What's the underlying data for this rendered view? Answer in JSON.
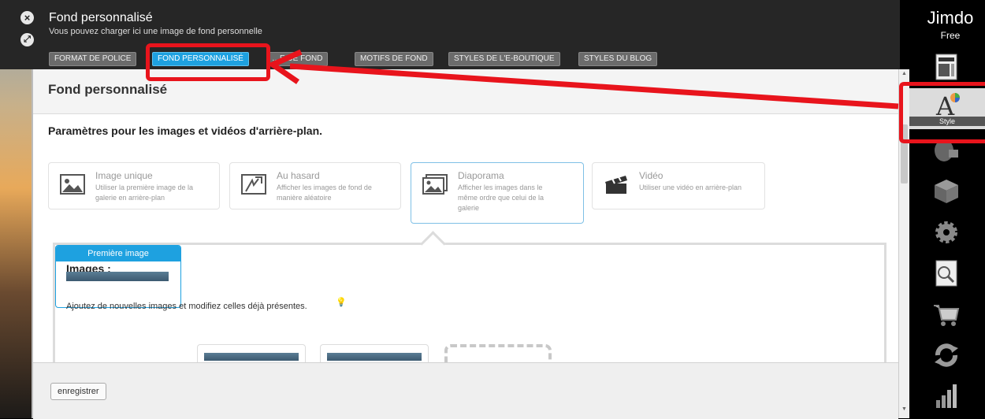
{
  "window": {
    "title": "Fond personnalisé",
    "subtitle": "Vous pouvez charger ici une image de fond personnelle",
    "close_icon": "close-icon",
    "resize_icon": "resize-icon"
  },
  "tabs": [
    {
      "label": "FORMAT DE POLICE",
      "active": false
    },
    {
      "label": "FOND PERSONNALISÉ",
      "active": true
    },
    {
      "label": "…E DE FOND",
      "active": false
    },
    {
      "label": "MOTIFS DE FOND",
      "active": false
    },
    {
      "label": "STYLES DE L'E-BOUTIQUE",
      "active": false
    },
    {
      "label": "STYLES DU BLOG",
      "active": false
    }
  ],
  "panel": {
    "title": "Fond personnalisé",
    "section_title": "Paramètres pour les images et vidéos d'arrière-plan.",
    "modes": [
      {
        "title": "Image unique",
        "desc_lines": [
          "Utiliser la première image de la",
          "galerie en arrière-plan"
        ],
        "icon": "image-icon",
        "selected": false
      },
      {
        "title": "Au hasard",
        "desc_lines": [
          "Afficher les images de fond de",
          "manière aléatoire"
        ],
        "icon": "shuffle-image-icon",
        "selected": false
      },
      {
        "title": "Diaporama",
        "desc_lines": [
          "Afficher les images dans le",
          "même ordre que celui de la",
          "galerie"
        ],
        "icon": "slideshow-icon",
        "selected": true
      },
      {
        "title": "Vidéo",
        "desc_lines": [
          "Utiliser une vidéo en arrière-plan"
        ],
        "icon": "clapperboard-icon",
        "selected": false
      }
    ],
    "images": {
      "title": "Images :",
      "desc": "Ajoutez de nouvelles images et modifiez celles déjà présentes.",
      "first_label": "Première image"
    },
    "save_label": "enregistrer"
  },
  "sidebar": {
    "logo": "Jimdo",
    "plan": "Free",
    "style_label": "Style",
    "items": [
      "layout-icon",
      "style-icon",
      "marketing-icon",
      "package-icon",
      "settings-icon",
      "seo-icon",
      "shop-cart-icon",
      "sync-icon",
      "statistics-icon"
    ]
  },
  "colors": {
    "highlight": "#e8141c",
    "active_tab": "#1ea1e0"
  }
}
